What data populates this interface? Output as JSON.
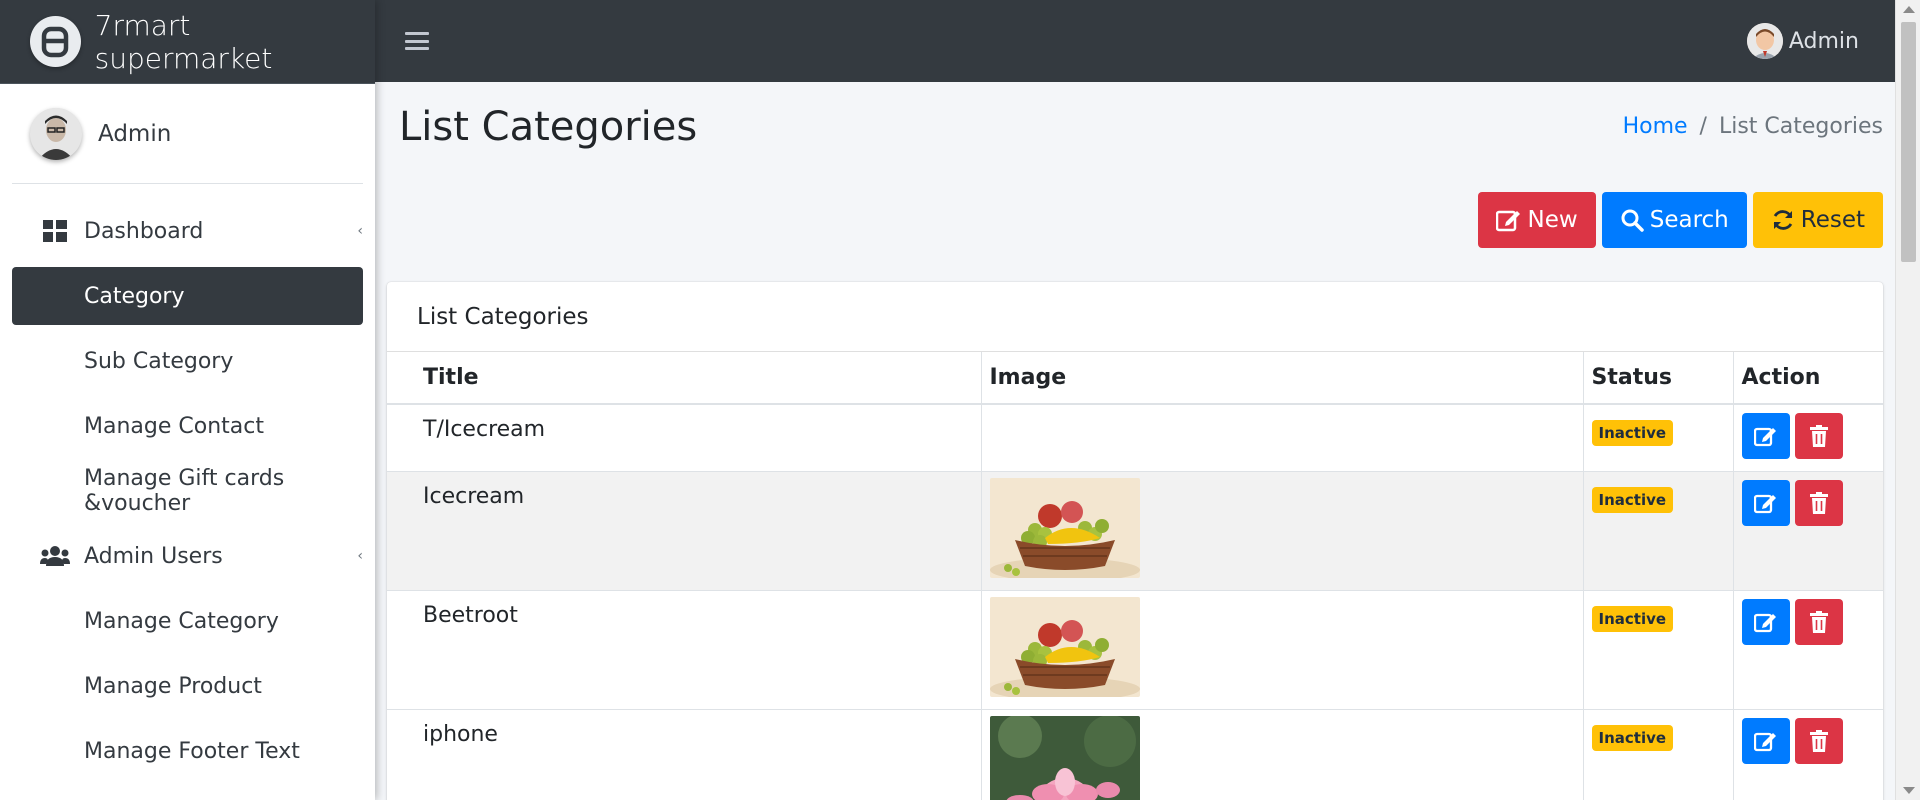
{
  "brand": {
    "name": "7rmart supermarket"
  },
  "sidebar": {
    "user": {
      "name": "Admin"
    },
    "items": [
      {
        "label": "Dashboard",
        "icon": "dashboard-icon",
        "has_caret": true
      },
      {
        "label": "Category",
        "active": true
      },
      {
        "label": "Sub Category"
      },
      {
        "label": "Manage Contact"
      },
      {
        "label": "Manage Gift cards &voucher"
      },
      {
        "label": "Admin Users",
        "icon": "users-icon",
        "has_caret": true
      },
      {
        "label": "Manage Category"
      },
      {
        "label": "Manage Product"
      },
      {
        "label": "Manage Footer Text"
      }
    ]
  },
  "topbar": {
    "user_name": "Admin"
  },
  "page": {
    "title": "List Categories",
    "breadcrumb": {
      "home": "Home",
      "separator": "/",
      "current": "List Categories"
    }
  },
  "actions": {
    "new_label": "New",
    "search_label": "Search",
    "reset_label": "Reset"
  },
  "card": {
    "title": "List Categories",
    "columns": [
      "Title",
      "Image",
      "Status",
      "Action"
    ],
    "rows": [
      {
        "title": "T/Icecream",
        "image": "",
        "status": "Inactive"
      },
      {
        "title": "Icecream",
        "image": "fruit-basket",
        "status": "Inactive"
      },
      {
        "title": "Beetroot",
        "image": "fruit-basket",
        "status": "Inactive"
      },
      {
        "title": "iphone",
        "image": "lotus-flower",
        "status": "Inactive"
      }
    ]
  },
  "colors": {
    "sidebar_dark": "#343a40",
    "primary": "#007bff",
    "danger": "#dc3545",
    "warning": "#ffc107",
    "background": "#f4f6f9"
  }
}
